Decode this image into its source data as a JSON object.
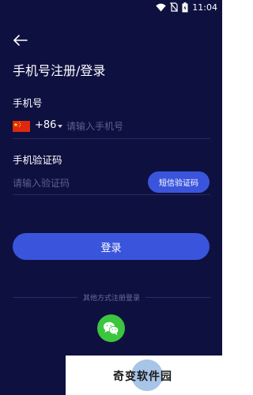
{
  "statusbar": {
    "time": "11:04",
    "icons": [
      "wifi-icon",
      "no-sim-icon",
      "battery-icon"
    ]
  },
  "header": {
    "back_icon": "back-arrow-icon",
    "title": "手机号注册/登录"
  },
  "phone": {
    "label": "手机号",
    "flag": "china-flag-icon",
    "country_code": "+86",
    "placeholder": "请输入手机号",
    "value": ""
  },
  "code": {
    "label": "手机验证码",
    "placeholder": "请输入验证码",
    "value": "",
    "send_button": "短信验证码"
  },
  "login_button": "登录",
  "other": {
    "label": "其他方式注册登录",
    "methods": [
      "wechat-icon"
    ]
  },
  "watermark": {
    "text": "奇变软件园"
  },
  "colors": {
    "background": "#0e1040",
    "accent": "#3a55dc",
    "wechat": "#3cc63e",
    "placeholder": "#5d618d",
    "divider": "#272a5a"
  }
}
